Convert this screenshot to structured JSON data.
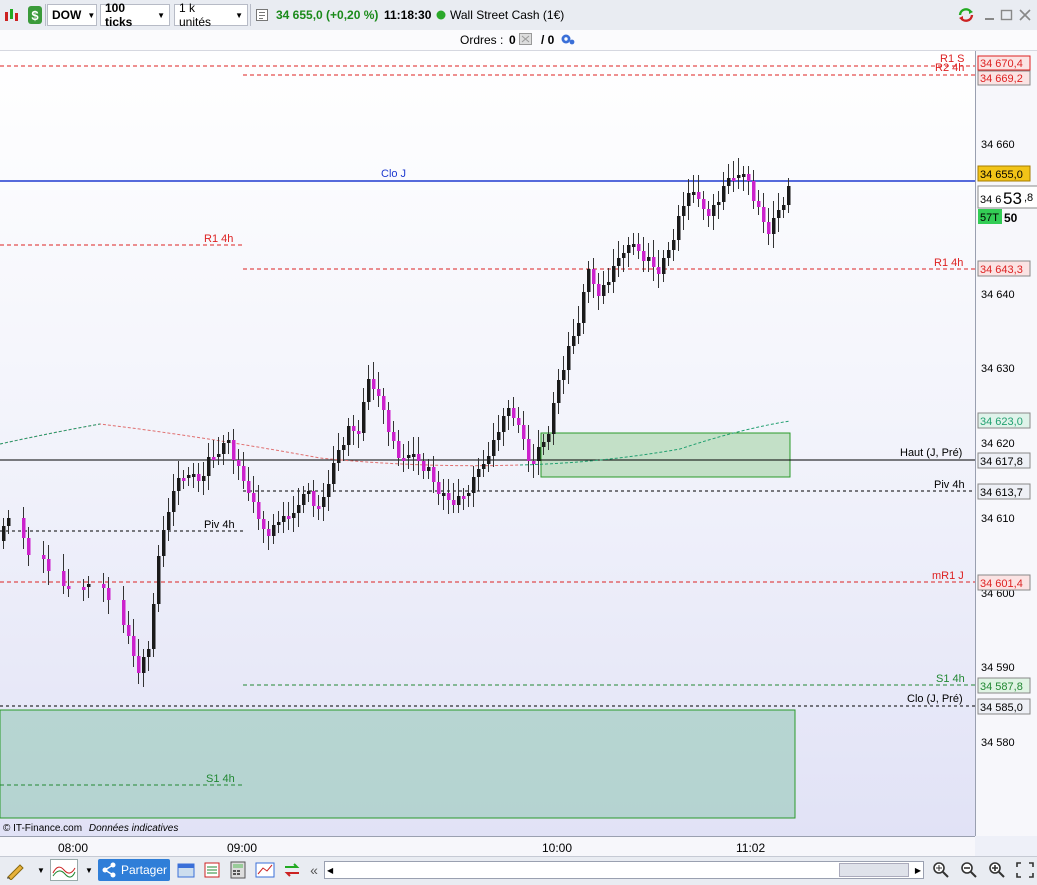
{
  "toolbar": {
    "instrument": "DOW",
    "ticks": "100 ticks",
    "units": "1 k unités",
    "price_change": "34 655,0 (+0,20 %)",
    "time": "11:18:30",
    "market_name": "Wall Street Cash (1€)"
  },
  "orders": {
    "label": "Ordres :",
    "buy_count": "0",
    "sell_count": "/ 0"
  },
  "copyright": "© IT-Finance.com",
  "disclaimer": "Données indicatives",
  "time_axis": [
    "08:00",
    "09:00",
    "10:00",
    "11:02"
  ],
  "price_axis": [
    "34 660",
    "34 640",
    "34 630",
    "34 620",
    "34 610",
    "34 600",
    "34 590",
    "34 580"
  ],
  "levels": {
    "r1s": {
      "label": "R1 S"
    },
    "r2_4h": {
      "label": "R2 4h",
      "value": "34 670,4"
    },
    "r2_4h_b": {
      "value": "34 669,2"
    },
    "clo_j": {
      "label": "Clo J",
      "value": "34 655,0"
    },
    "r1_4h_left": {
      "label": "R1 4h"
    },
    "r1_4h": {
      "label": "R1 4h",
      "value": "34 643,3"
    },
    "ma_green": {
      "value": "34 623,0"
    },
    "haut": {
      "label": "Haut (J, Pré)",
      "value": "34 617,8"
    },
    "piv_4h": {
      "label": "Piv 4h",
      "value": "34 613,7"
    },
    "piv_4h_left": {
      "label": "Piv 4h"
    },
    "mr1_j": {
      "label": "mR1 J",
      "value": "34 601,4"
    },
    "s1_4h": {
      "label": "S1 4h",
      "value": "34 587,8"
    },
    "clo_j_pre": {
      "label": "Clo (J, Pré)",
      "value": "34 585,0"
    },
    "s1_4h_left": {
      "label": "S1 4h"
    }
  },
  "bid_box": {
    "prefix": "34 6",
    "big": "53",
    "suffix": ",8"
  },
  "badge": {
    "prefix": "57T",
    "suffix": "50"
  },
  "bottom": {
    "share_label": "Partager"
  },
  "colors": {
    "bull": "#1a1a1a",
    "bear": "#cc22cc",
    "resistance": "#dd2222",
    "support": "#228833",
    "close": "#1e3ad0"
  }
}
